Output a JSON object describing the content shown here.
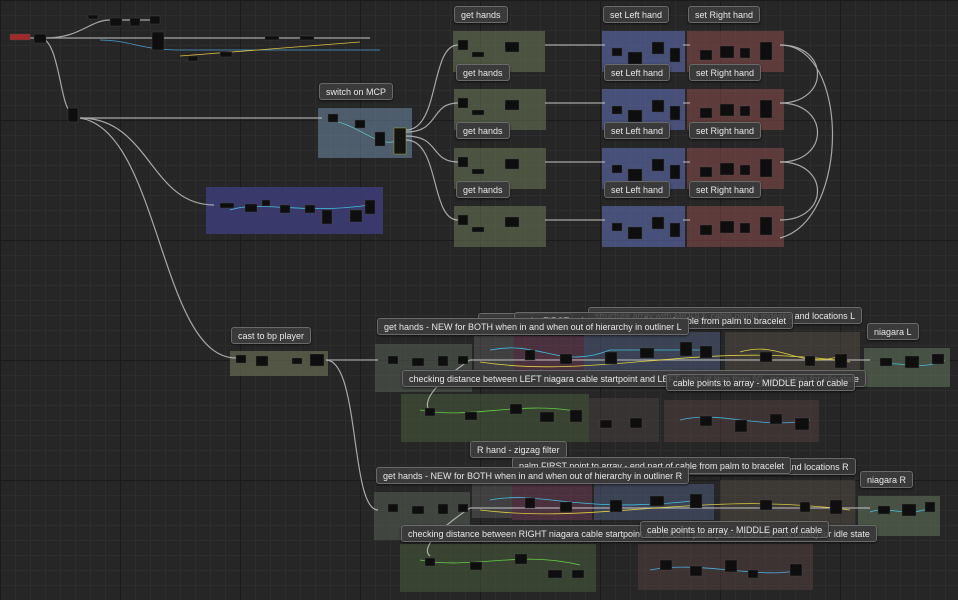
{
  "graph": {
    "comments": [
      {
        "id": "get-hands-1",
        "text": "get hands"
      },
      {
        "id": "set-left-hand-1",
        "text": "set Left hand"
      },
      {
        "id": "set-right-hand-1",
        "text": "set Right hand"
      },
      {
        "id": "get-hands-2",
        "text": "get hands"
      },
      {
        "id": "set-left-hand-2",
        "text": "set Left hand"
      },
      {
        "id": "set-right-hand-2",
        "text": "set Right hand"
      },
      {
        "id": "switch-on-mcp",
        "text": "switch on MCP"
      },
      {
        "id": "get-hands-3",
        "text": "get hands"
      },
      {
        "id": "set-left-hand-3",
        "text": "set Left hand"
      },
      {
        "id": "set-right-hand-3",
        "text": "set Right hand"
      },
      {
        "id": "get-hands-4",
        "text": "get hands"
      },
      {
        "id": "set-left-hand-4",
        "text": "set Left hand"
      },
      {
        "id": "set-right-hand-4",
        "text": "set Right hand"
      },
      {
        "id": "cast-to-bp-player",
        "text": "cast to bp player"
      },
      {
        "id": "structure-array-l",
        "text": "structure array with MIDDLE cable points indexes and locations L"
      },
      {
        "id": "l-hand-zigzag",
        "text": "L hand - zigzag filter"
      },
      {
        "id": "palm-first-point-l",
        "text": "palm FIRST point to array - end part of cable from palm to bracelet"
      },
      {
        "id": "get-hands-new-l",
        "text": "get hands - NEW for BOTH when in and when out of hierarchy in outliner L"
      },
      {
        "id": "niagara-l",
        "text": "niagara L"
      },
      {
        "id": "checking-distance-left",
        "text": "checking distance between LEFT niagara cable startpoint and LEFT palm (if less than 50 - no cable) for idle state"
      },
      {
        "id": "cable-points-middle-l",
        "text": "cable points to array - MIDDLE part of cable"
      },
      {
        "id": "r-hand-zigzag",
        "text": "R hand - zigzag filter"
      },
      {
        "id": "structure-array-r",
        "text": "structure array with MIDDLE cable points indexes and locations R"
      },
      {
        "id": "palm-first-point-r",
        "text": "palm FIRST point to array - end part of cable from palm to bracelet"
      },
      {
        "id": "get-hands-new-r",
        "text": "get hands - NEW for BOTH when in and when out of hierarchy in outliner R"
      },
      {
        "id": "niagara-r",
        "text": "niagara R"
      },
      {
        "id": "checking-distance-right",
        "text": "checking distance between RIGHT niagara cable startpoint and RIGHT palm (if less than 50 - no cable) for idle state"
      },
      {
        "id": "cable-points-middle-r",
        "text": "cable points to array - MIDDLE part of cable"
      }
    ]
  },
  "colors": {
    "background": "#262626",
    "wire": "#c8c8c8",
    "node": "#101010",
    "blue_comment": "#5a6aa0",
    "red_comment": "#8a4a4a",
    "green_comment": "#6a7a55"
  }
}
